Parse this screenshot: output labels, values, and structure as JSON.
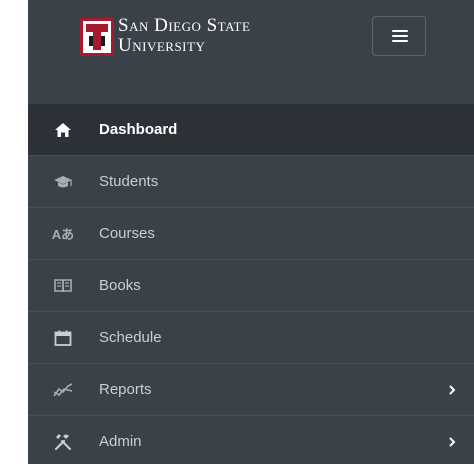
{
  "brand": {
    "line1": "San Diego State",
    "line2": "University"
  },
  "nav": {
    "items": [
      {
        "label": "Dashboard",
        "icon": "home-icon",
        "active": true
      },
      {
        "label": "Students",
        "icon": "graduation-cap-icon",
        "active": false
      },
      {
        "label": "Courses",
        "icon": "language-icon",
        "active": false,
        "icon_text": "Aあ"
      },
      {
        "label": "Books",
        "icon": "book-open-icon",
        "active": false
      },
      {
        "label": "Schedule",
        "icon": "calendar-icon",
        "active": false
      },
      {
        "label": "Reports",
        "icon": "line-chart-icon",
        "active": false,
        "has_submenu": true
      },
      {
        "label": "Admin",
        "icon": "tools-icon",
        "active": false,
        "has_submenu": true
      }
    ]
  },
  "colors": {
    "sidebar_bg": "#3b4148",
    "active_bg": "#2c3137",
    "logo_red": "#a6192e",
    "text": "#c9ced4"
  }
}
